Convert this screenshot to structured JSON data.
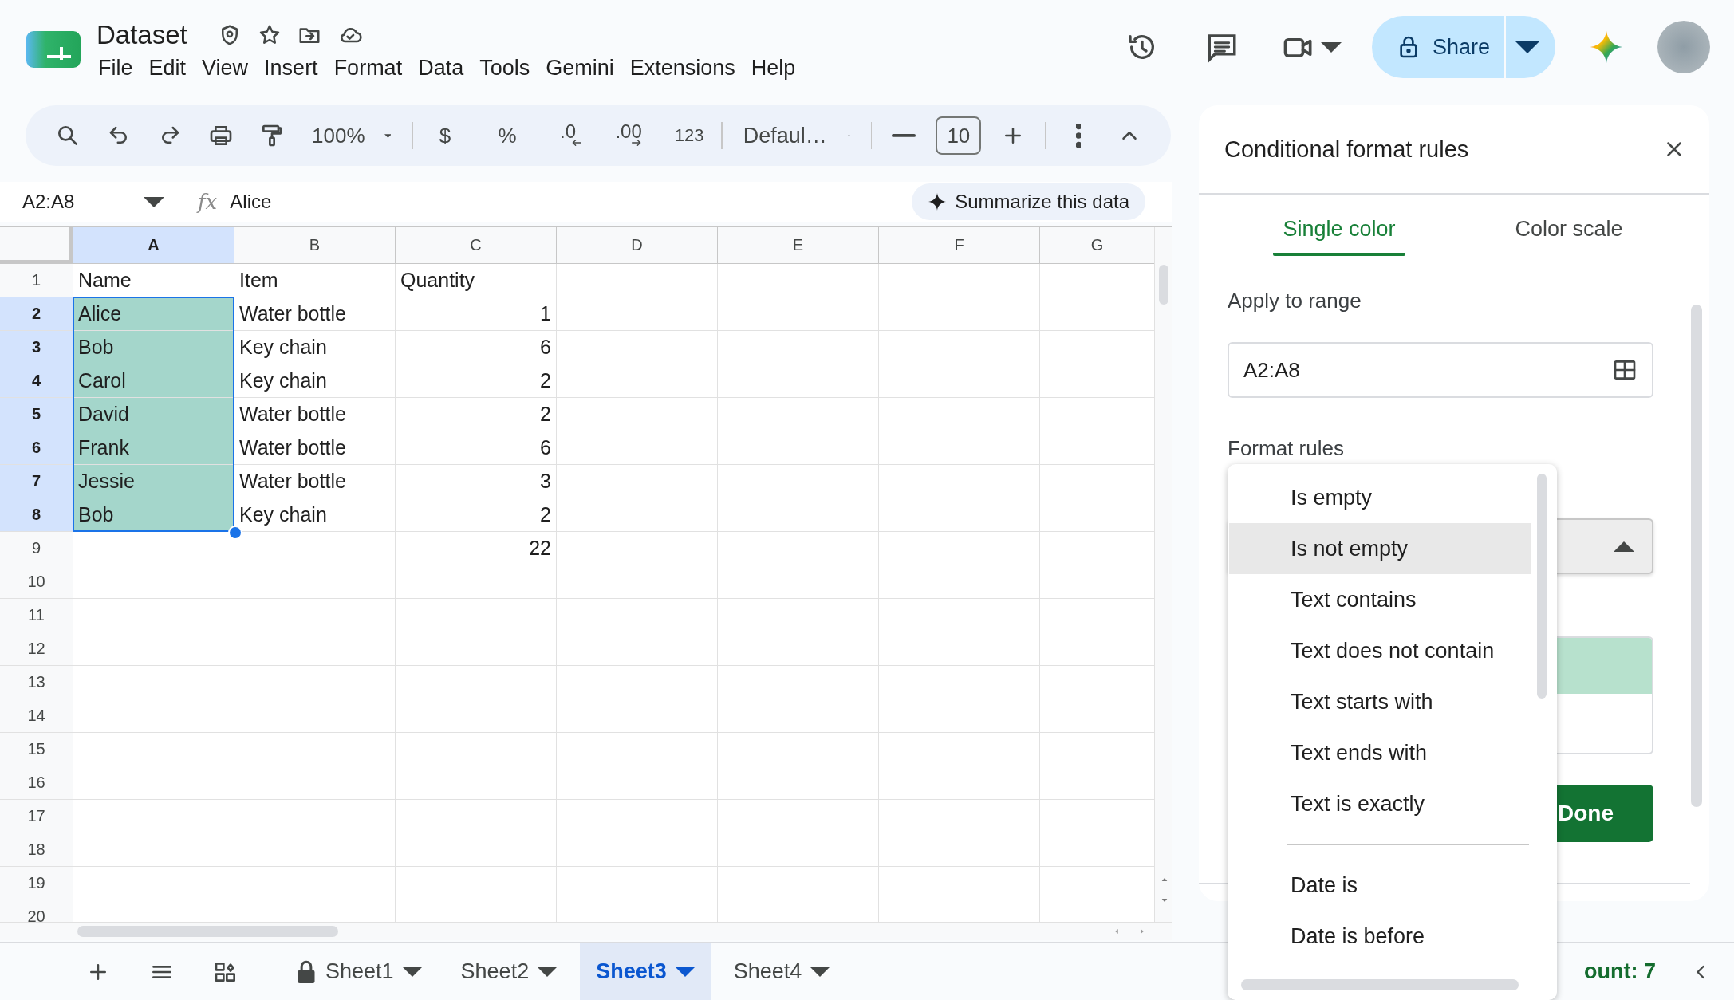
{
  "header": {
    "title": "Dataset",
    "menu": [
      "File",
      "Edit",
      "View",
      "Insert",
      "Format",
      "Data",
      "Tools",
      "Gemini",
      "Extensions",
      "Help"
    ],
    "share": "Share"
  },
  "toolbar": {
    "zoom": "100%",
    "currency": "$",
    "percent": "%",
    "decrease_decimals": ".0",
    "increase_decimals": ".00",
    "number_format": "123",
    "font": "Defaul…",
    "font_size": "10"
  },
  "formula_bar": {
    "name_box": "A2:A8",
    "function_icon": "fx",
    "content": "Alice",
    "summarize": "Summarize this data"
  },
  "grid": {
    "columns": [
      {
        "label": "A",
        "selected": true
      },
      {
        "label": "B",
        "selected": false
      },
      {
        "label": "C",
        "selected": false
      },
      {
        "label": "D",
        "selected": false
      },
      {
        "label": "E",
        "selected": false
      },
      {
        "label": "F",
        "selected": false
      },
      {
        "label": "G",
        "selected": false
      }
    ],
    "rows": [
      {
        "label": "1",
        "selected": false,
        "cells": [
          {
            "kind": "text",
            "text": "Name"
          },
          {
            "kind": "text",
            "text": "Item"
          },
          {
            "kind": "text",
            "text": "Quantity"
          }
        ]
      },
      {
        "label": "2",
        "selected": true,
        "cells": [
          {
            "kind": "text",
            "text": "Alice"
          },
          {
            "kind": "text",
            "text": "Water bottle"
          },
          {
            "kind": "number",
            "text": "1"
          }
        ]
      },
      {
        "label": "3",
        "selected": true,
        "cells": [
          {
            "kind": "text",
            "text": "Bob"
          },
          {
            "kind": "text",
            "text": "Key chain"
          },
          {
            "kind": "number",
            "text": "6"
          }
        ]
      },
      {
        "label": "4",
        "selected": true,
        "cells": [
          {
            "kind": "text",
            "text": "Carol"
          },
          {
            "kind": "text",
            "text": "Key chain"
          },
          {
            "kind": "number",
            "text": "2"
          }
        ]
      },
      {
        "label": "5",
        "selected": true,
        "cells": [
          {
            "kind": "text",
            "text": "David"
          },
          {
            "kind": "text",
            "text": "Water bottle"
          },
          {
            "kind": "number",
            "text": "2"
          }
        ]
      },
      {
        "label": "6",
        "selected": true,
        "cells": [
          {
            "kind": "text",
            "text": "Frank"
          },
          {
            "kind": "text",
            "text": "Water bottle"
          },
          {
            "kind": "number",
            "text": "6"
          }
        ]
      },
      {
        "label": "7",
        "selected": true,
        "cells": [
          {
            "kind": "text",
            "text": "Jessie"
          },
          {
            "kind": "text",
            "text": "Water bottle"
          },
          {
            "kind": "number",
            "text": "3"
          }
        ]
      },
      {
        "label": "8",
        "selected": true,
        "cells": [
          {
            "kind": "text",
            "text": "Bob"
          },
          {
            "kind": "text",
            "text": "Key chain"
          },
          {
            "kind": "number",
            "text": "2"
          }
        ]
      },
      {
        "label": "9",
        "selected": false,
        "cells": [
          {
            "kind": "empty"
          },
          {
            "kind": "empty"
          },
          {
            "kind": "number",
            "text": "22"
          }
        ]
      },
      {
        "label": "10",
        "selected": false
      },
      {
        "label": "11",
        "selected": false
      },
      {
        "label": "12",
        "selected": false
      },
      {
        "label": "13",
        "selected": false
      },
      {
        "label": "14",
        "selected": false
      },
      {
        "label": "15",
        "selected": false
      },
      {
        "label": "16",
        "selected": false
      },
      {
        "label": "17",
        "selected": false
      },
      {
        "label": "18",
        "selected": false
      },
      {
        "label": "19",
        "selected": false
      },
      {
        "label": "20",
        "selected": false
      }
    ]
  },
  "panel": {
    "title": "Conditional format rules",
    "tabs": [
      {
        "label": "Single color",
        "selected": true
      },
      {
        "label": "Color scale",
        "selected": false
      }
    ],
    "range_label": "Apply to range",
    "range": "A2:A8",
    "rules_label": "Format rules",
    "done": "Done"
  },
  "condition_menu": {
    "items": [
      {
        "kind": "option",
        "label": "Is empty",
        "selected": false
      },
      {
        "kind": "option",
        "label": "Is not empty",
        "selected": true
      },
      {
        "kind": "option",
        "label": "Text contains",
        "selected": false
      },
      {
        "kind": "option",
        "label": "Text does not contain",
        "selected": false
      },
      {
        "kind": "option",
        "label": "Text starts with",
        "selected": false
      },
      {
        "kind": "option",
        "label": "Text ends with",
        "selected": false
      },
      {
        "kind": "option",
        "label": "Text is exactly",
        "selected": false
      },
      {
        "kind": "separator"
      },
      {
        "kind": "option",
        "label": "Date is",
        "selected": false
      },
      {
        "kind": "option",
        "label": "Date is before",
        "selected": false
      }
    ]
  },
  "sheet_tabs": {
    "sheets": [
      {
        "name": "Sheet1",
        "selected": false,
        "locked": true
      },
      {
        "name": "Sheet2",
        "selected": false,
        "locked": false
      },
      {
        "name": "Sheet3",
        "selected": true,
        "locked": false
      },
      {
        "name": "Sheet4",
        "selected": false,
        "locked": false
      }
    ],
    "status": "ount: 7"
  }
}
